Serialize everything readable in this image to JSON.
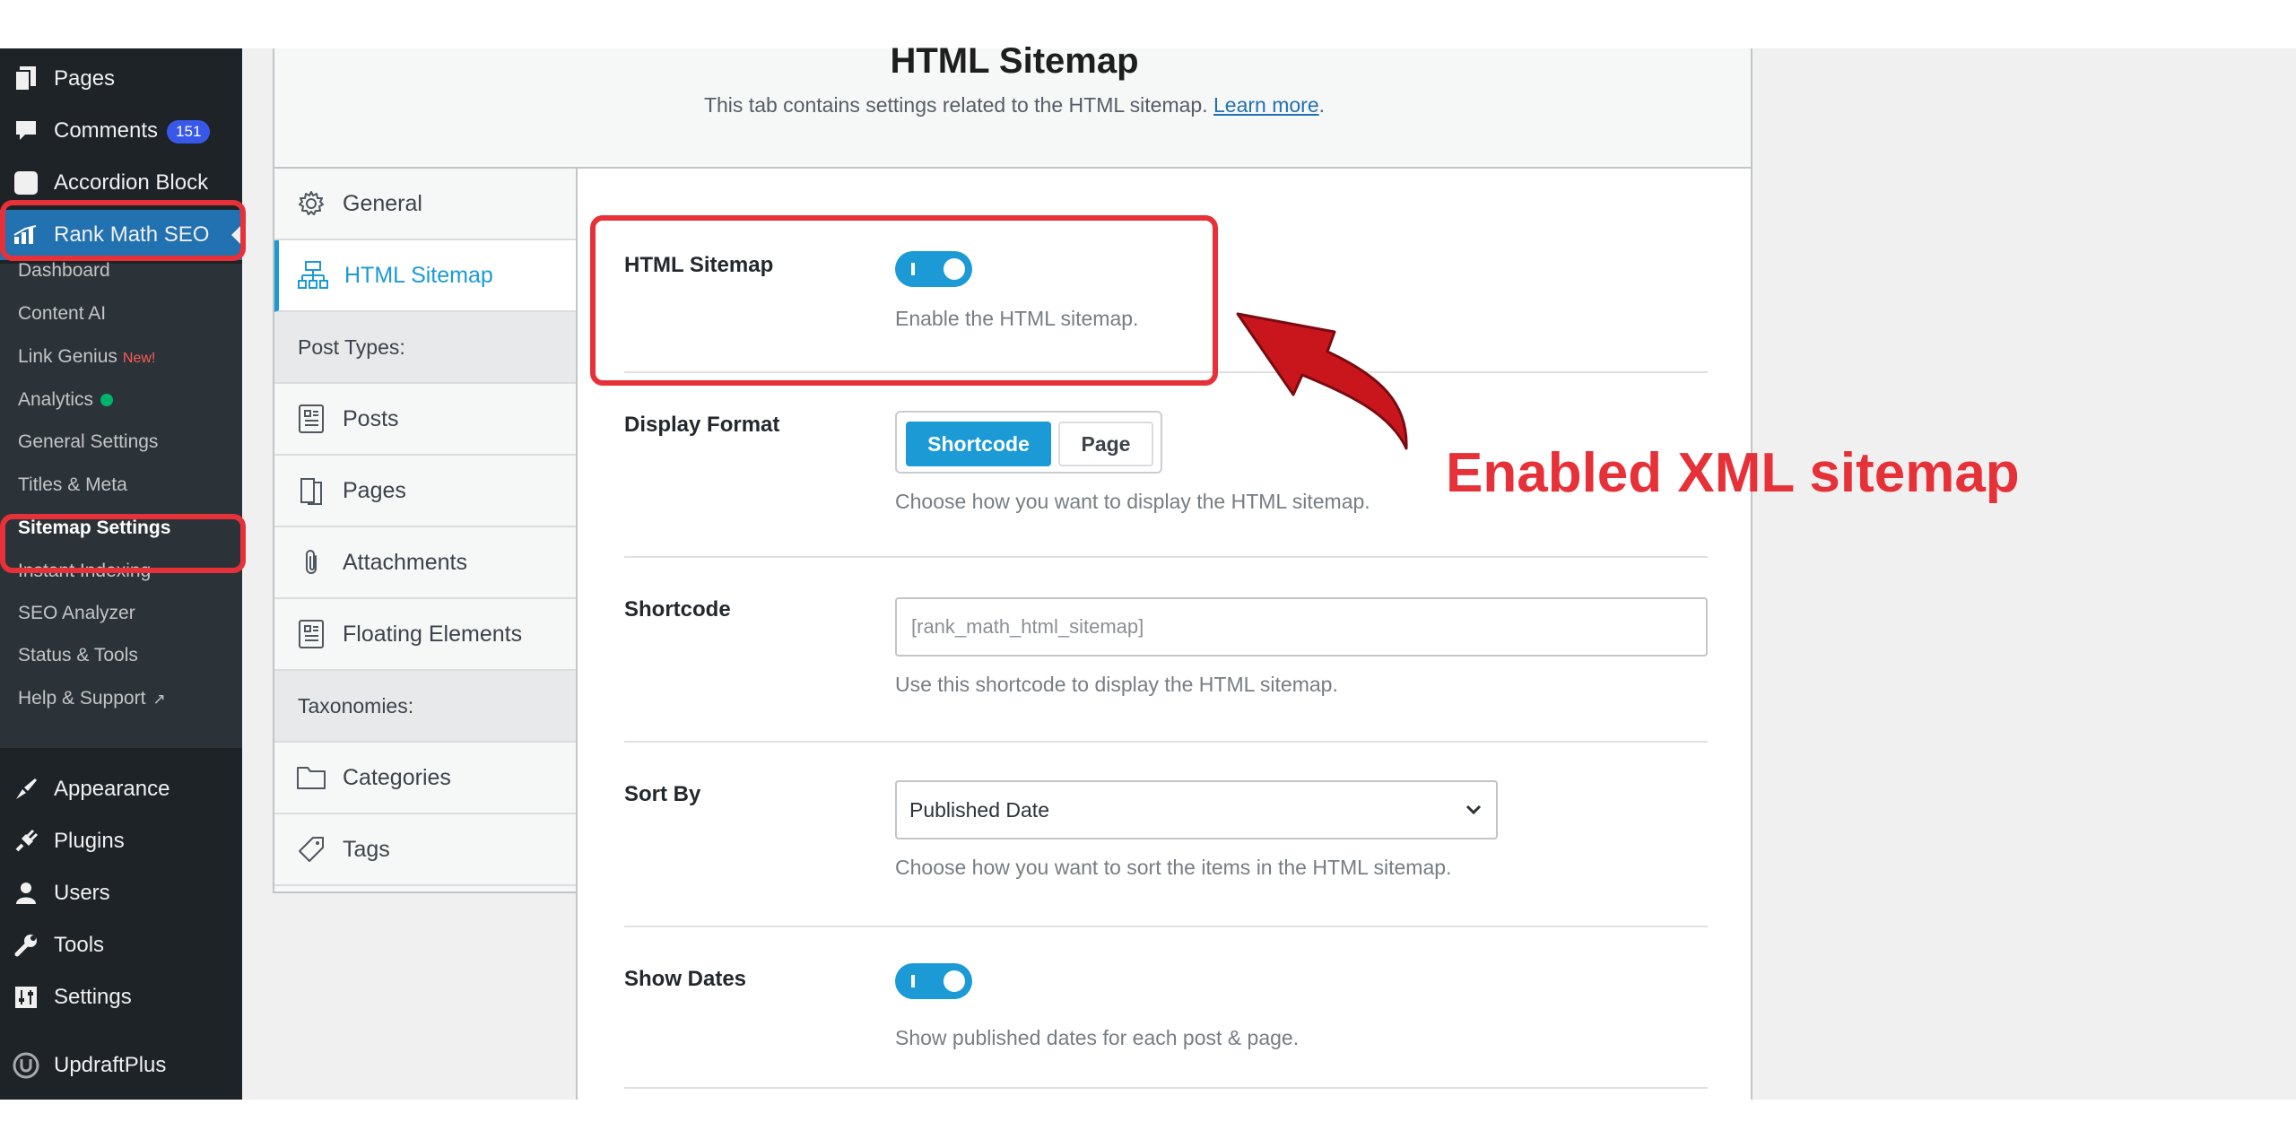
{
  "sidebar": {
    "top_items": [
      {
        "label": "Pages",
        "icon": "pages-icon"
      },
      {
        "label": "Comments",
        "icon": "comment-icon",
        "badge": "151"
      },
      {
        "label": "Accordion Block",
        "icon": "block-icon"
      },
      {
        "label": "Rank Math SEO",
        "icon": "rank-math-icon"
      }
    ],
    "submenu": [
      {
        "label": "Dashboard"
      },
      {
        "label": "Content AI"
      },
      {
        "label": "Link Genius",
        "tag": "New!"
      },
      {
        "label": "Analytics"
      },
      {
        "label": "General Settings"
      },
      {
        "label": "Titles & Meta"
      },
      {
        "label": "Sitemap Settings"
      },
      {
        "label": "Instant Indexing"
      },
      {
        "label": "SEO Analyzer"
      },
      {
        "label": "Status & Tools"
      },
      {
        "label": "Help & Support"
      }
    ],
    "bottom_items": [
      {
        "label": "Appearance",
        "icon": "brush-icon"
      },
      {
        "label": "Plugins",
        "icon": "plugin-icon"
      },
      {
        "label": "Users",
        "icon": "user-icon"
      },
      {
        "label": "Tools",
        "icon": "wrench-icon"
      },
      {
        "label": "Settings",
        "icon": "settings-icon"
      },
      {
        "label": "UpdraftPlus",
        "icon": "updraft-icon"
      }
    ]
  },
  "header": {
    "title": "HTML Sitemap",
    "description": "This tab contains settings related to the HTML sitemap.",
    "learn_more": "Learn more",
    "period": "."
  },
  "tabs": {
    "general": "General",
    "html_sitemap": "HTML Sitemap",
    "post_types_heading": "Post Types:",
    "posts": "Posts",
    "pages": "Pages",
    "attachments": "Attachments",
    "floating_elements": "Floating Elements",
    "taxonomies_heading": "Taxonomies:",
    "categories": "Categories",
    "tags": "Tags"
  },
  "settings": {
    "html_sitemap": {
      "label": "HTML Sitemap",
      "enabled": true,
      "desc": "Enable the HTML sitemap."
    },
    "display_format": {
      "label": "Display Format",
      "options": [
        "Shortcode",
        "Page"
      ],
      "selected": "Shortcode",
      "desc": "Choose how you want to display the HTML sitemap."
    },
    "shortcode": {
      "label": "Shortcode",
      "value": "[rank_math_html_sitemap]",
      "desc": "Use this shortcode to display the HTML sitemap."
    },
    "sort_by": {
      "label": "Sort By",
      "value": "Published Date",
      "desc": "Choose how you want to sort the items in the HTML sitemap."
    },
    "show_dates": {
      "label": "Show Dates",
      "enabled": true,
      "desc": "Show published dates for each post & page."
    }
  },
  "annotation": {
    "text": "Enabled XML sitemap",
    "color": "#e63138"
  },
  "colors": {
    "accent": "#1b9ad6",
    "wp_sidebar": "#1d2327",
    "wp_active": "#2271b1",
    "highlight": "#e63138"
  }
}
